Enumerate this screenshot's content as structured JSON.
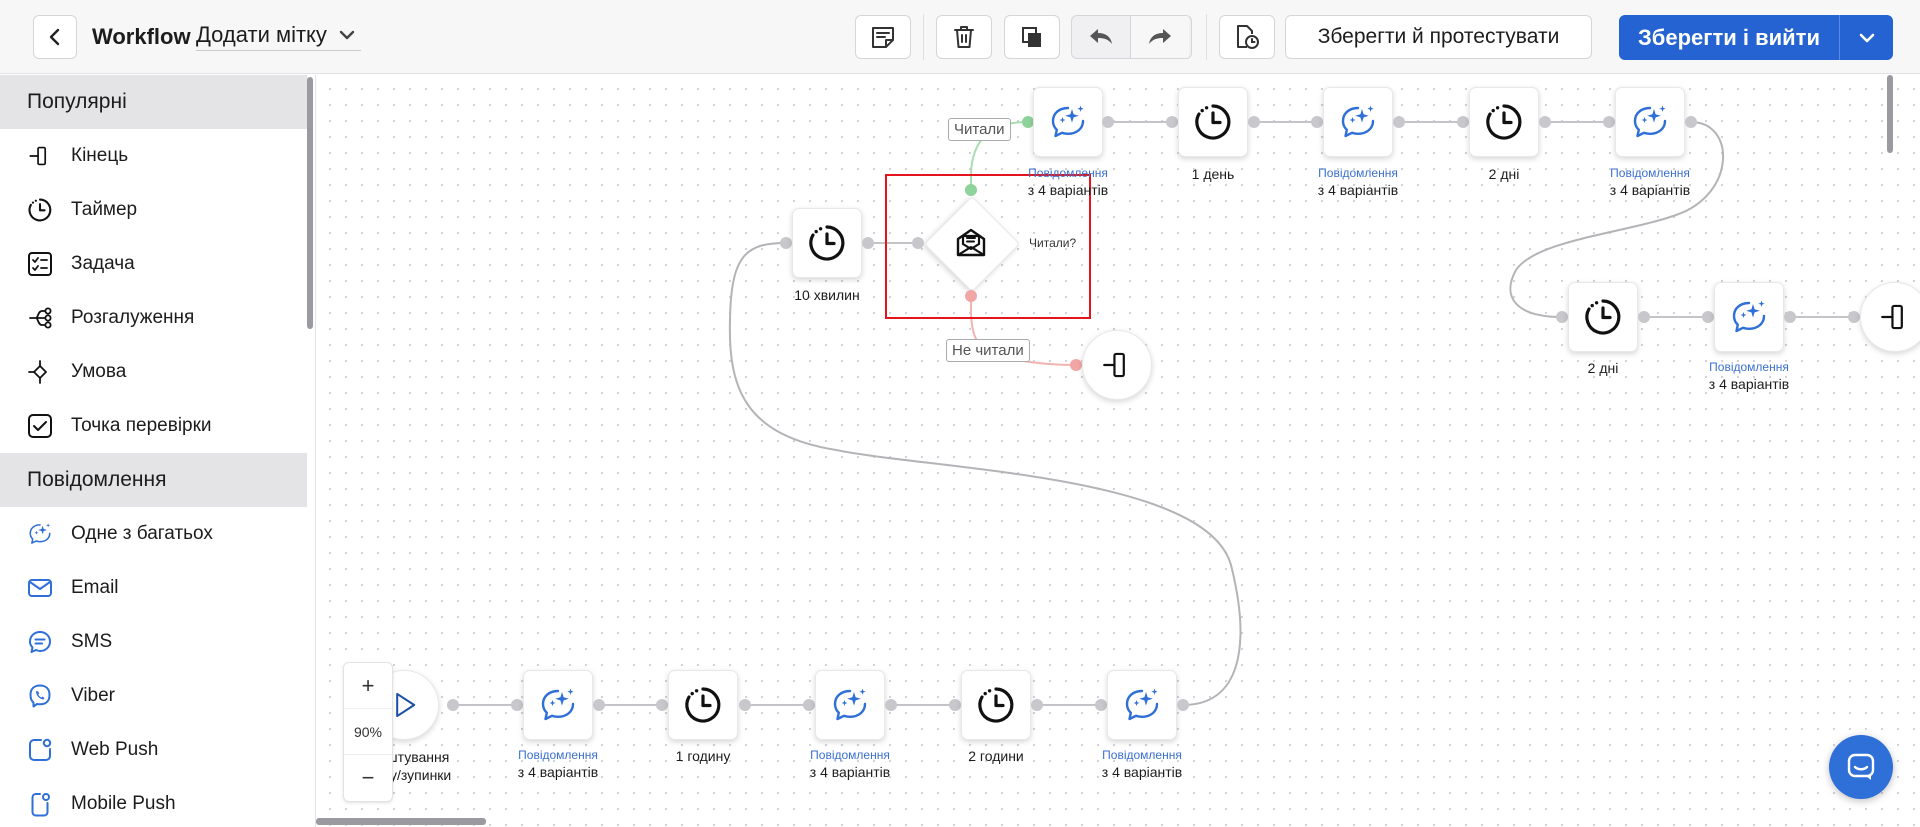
{
  "header": {
    "title": "Workflow",
    "tag_label": "Додати мітку",
    "save_test_label": "Зберегти й протестувати",
    "save_exit_label": "Зберегти і вийти"
  },
  "sidebar": {
    "sections": [
      {
        "title": "Популярні",
        "items": [
          {
            "label": "Кінець",
            "icon": "end-icon"
          },
          {
            "label": "Таймер",
            "icon": "timer-icon"
          },
          {
            "label": "Задача",
            "icon": "task-icon"
          },
          {
            "label": "Розгалуження",
            "icon": "branch-icon"
          },
          {
            "label": "Умова",
            "icon": "condition-icon"
          },
          {
            "label": "Точка перевірки",
            "icon": "checkpoint-icon"
          }
        ]
      },
      {
        "title": "Повідомлення",
        "items": [
          {
            "label": "Одне з багатьох",
            "icon": "sparkle-chat-icon"
          },
          {
            "label": "Email",
            "icon": "email-icon"
          },
          {
            "label": "SMS",
            "icon": "sms-icon"
          },
          {
            "label": "Viber",
            "icon": "viber-icon"
          },
          {
            "label": "Web Push",
            "icon": "web-push-icon"
          },
          {
            "label": "Mobile Push",
            "icon": "mobile-push-icon"
          }
        ]
      }
    ]
  },
  "canvas": {
    "start_caption_1": "аштування",
    "start_caption_2": "ску/зупинки",
    "message_title": "Повідомлення",
    "variants_caption": "з 4 варіантів",
    "timer_1h": "1 годину",
    "timer_2h": "2 години",
    "timer_10m": "10 хвилин",
    "timer_1d": "1 день",
    "timer_2d": "2 дні",
    "condition_question": "Читали?",
    "label_read": "Читали",
    "label_not_read": "Не читали",
    "zoom_plus": "+",
    "zoom_level": "90%",
    "zoom_minus": "−"
  },
  "colors": {
    "primary": "#2463d1",
    "selection": "#e5131b",
    "yes_branch": "#8ed39b",
    "no_branch": "#f2a5a5",
    "message_icon": "#2e6fd8"
  }
}
